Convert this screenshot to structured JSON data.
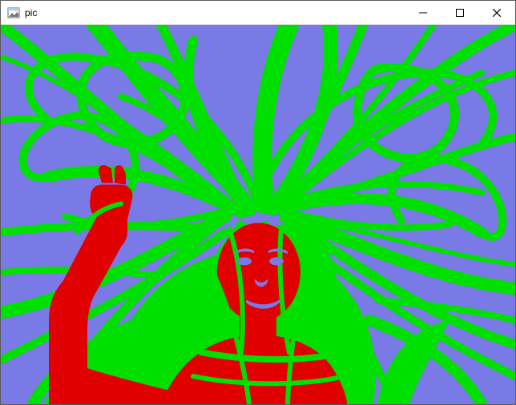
{
  "window": {
    "title": "pic"
  },
  "titlebar": {
    "icon_name": "app-image-icon",
    "minimize_name": "minimize-icon",
    "maximize_name": "maximize-icon",
    "close_name": "close-icon"
  },
  "image": {
    "colors": {
      "background": "#7A7AE6",
      "hair": "#00E000",
      "skin": "#E00000"
    },
    "subject": "posterized-portrait",
    "description": "Three-tone posterized image: purple background, green flowing hair strands, red figure (face, raised arm, shoulders)."
  }
}
